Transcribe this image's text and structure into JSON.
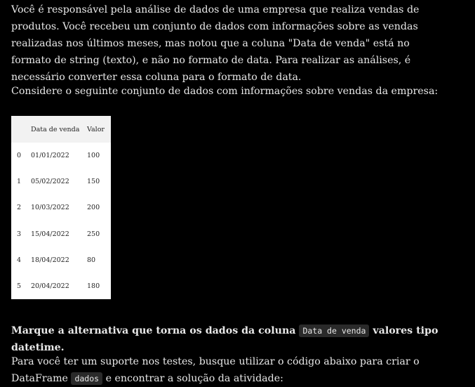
{
  "intro": {
    "paragraph1": "Você é responsável pela análise de dados de uma empresa que realiza vendas de produtos. Você recebeu um conjunto de dados com informações sobre as vendas realizadas nos últimos meses, mas notou que a coluna \"Data de venda\" está no formato de string (texto), e não no formato de data. Para realizar as análises, é necessário converter essa coluna para o formato de data.",
    "paragraph2": "Considere o seguinte conjunto de dados com informações sobre vendas da empresa:"
  },
  "table": {
    "headers": [
      "",
      "Data de venda",
      "Valor"
    ],
    "rows": [
      [
        "0",
        "01/01/2022",
        "100"
      ],
      [
        "1",
        "05/02/2022",
        "150"
      ],
      [
        "2",
        "10/03/2022",
        "200"
      ],
      [
        "3",
        "15/04/2022",
        "250"
      ],
      [
        "4",
        "18/04/2022",
        "80"
      ],
      [
        "5",
        "20/04/2022",
        "180"
      ]
    ]
  },
  "question": {
    "before": "Marque a alternativa que torna os dados da coluna ",
    "code": "Data de venda",
    "after": " valores tipo datetime."
  },
  "support": {
    "before": "Para você ter um suporte nos testes, busque utilizar o código abaixo para criar o DataFrame ",
    "code": "dados",
    "after": " e encontrar a solução da atividade:"
  }
}
